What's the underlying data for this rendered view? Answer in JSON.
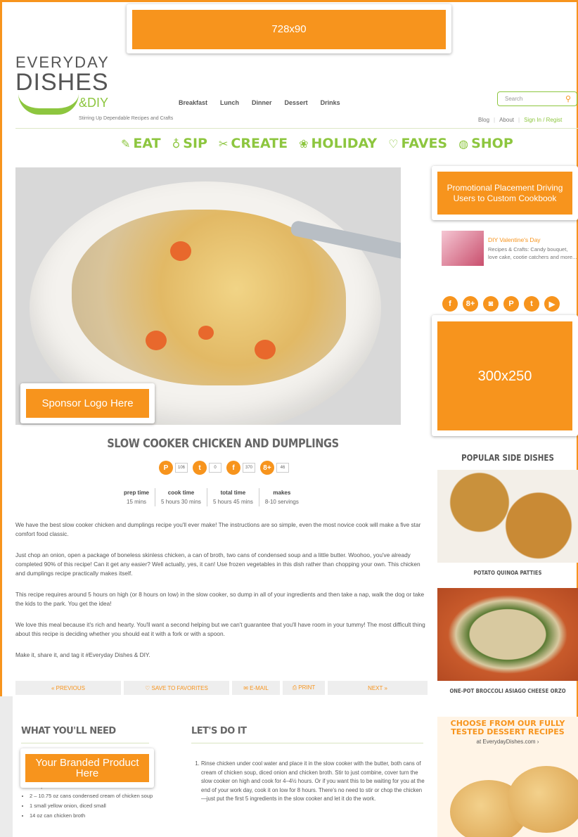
{
  "placements": {
    "leaderboard": "728x90",
    "promo": "Promotional Placement Driving Users to Custom Cookbook",
    "sponsor": "Sponsor Logo Here",
    "rectangle": "300x250",
    "branded": "Your Branded Product Here"
  },
  "logo": {
    "line1": "EVERYDAY",
    "line2": "DISHES",
    "diy": "&DIY",
    "tagline": "Stirring Up Dependable Recipes and Crafts"
  },
  "topnav": [
    "Breakfast",
    "Lunch",
    "Dinner",
    "Dessert",
    "Drinks"
  ],
  "search": {
    "placeholder": "Search"
  },
  "utility": {
    "blog": "Blog",
    "about": "About",
    "signin": "Sign In / Regist"
  },
  "catnav": [
    {
      "icon": "✎",
      "label": "EAT"
    },
    {
      "icon": "♁",
      "label": "SIP"
    },
    {
      "icon": "✂",
      "label": "CREATE"
    },
    {
      "icon": "❀",
      "label": "HOLIDAY"
    },
    {
      "icon": "♡",
      "label": "FAVES"
    },
    {
      "icon": "◍",
      "label": "SHOP"
    }
  ],
  "recipe": {
    "title": "SLOW COOKER CHICKEN AND DUMPLINGS",
    "shares": [
      {
        "icon": "P",
        "count": "106"
      },
      {
        "icon": "t",
        "count": "0"
      },
      {
        "icon": "f",
        "count": "370"
      },
      {
        "icon": "8+",
        "count": "46"
      }
    ],
    "timing": [
      {
        "label": "prep time",
        "value": "15 mins"
      },
      {
        "label": "cook time",
        "value": "5 hours 30 mins"
      },
      {
        "label": "total time",
        "value": "5 hours 45 mins"
      },
      {
        "label": "makes",
        "value": "8-10 servings"
      }
    ],
    "paragraphs": [
      "We have the best slow cooker chicken and dumplings recipe you'll ever make! The instructions are so simple, even the most novice cook will make a five star comfort food classic.",
      "Just chop an onion, open a package of boneless skinless chicken, a can of broth, two cans of condensed soup and a little butter. Woohoo, you've already completed 90% of this recipe! Can it get any easier? Well actually, yes, it can! Use frozen vegetables in this dish rather than chopping your own. This chicken and dumplings recipe practically makes itself.",
      "This recipe requires around 5 hours on high (or 8 hours on low) in the slow cooker, so dump in all of your ingredients and then take a nap, walk the dog or take the kids to the park. You get the idea!",
      "We love this meal because it's rich and hearty. You'll want a second helping but we can't guarantee that you'll have room in your tummy! The most difficult thing about this recipe is deciding whether you should eat it with a fork or with a spoon.",
      "Make it, share it, and tag it #Everyday Dishes & DIY."
    ],
    "pager": {
      "previous": "« PREVIOUS",
      "save": "♡ SAVE TO FAVORITES",
      "email": "✉ E-MAIL",
      "print": "⎙ PRINT",
      "next": "NEXT »"
    },
    "need_title": "WHAT YOU'LL NEED",
    "ingredients": [
      "2 tbsp of butter",
      "2 – 10.75 oz cans condensed cream of chicken soup",
      "1 small yellow onion, diced small",
      "14 oz can chicken broth"
    ],
    "doit_title": "LET'S DO IT",
    "step1": "Rinse chicken under cool water and place it in the slow cooker with the butter, both cans of cream of chicken soup, diced onion and chicken broth. Stir to just combine, cover turn the slow cooker on high and cook for 4–4½ hours. Or if you want this to be waiting for you at the end of your work day, cook it on low for 8 hours. There's no need to stir or chop the chicken—just put the first 5 ingredients in the slow cooker and let it do the work."
  },
  "sidebar": {
    "promo_title": "DIY Valentine's Day",
    "promo_desc": "Recipes & Crafts: Candy bouquet, love cake, cootie catchers and more...",
    "social": [
      "f",
      "8+",
      "◙",
      "P",
      "t",
      "▶"
    ],
    "popular_title": "POPULAR SIDE DISHES",
    "item1": "POTATO QUINOA PATTIES",
    "item2": "ONE-POT BROCCOLI ASIAGO CHEESE ORZO",
    "dessert_title": "CHOOSE FROM OUR FULLY TESTED DESSERT RECIPES",
    "dessert_url": "at EverydayDishes.com ›"
  },
  "colors": {
    "accent": "#f7941d",
    "brand_green": "#8dc63f"
  }
}
